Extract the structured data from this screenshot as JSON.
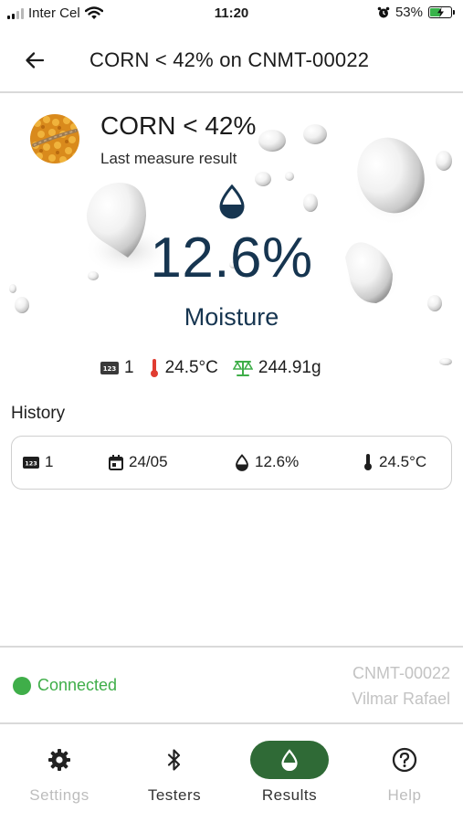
{
  "status_bar": {
    "carrier": "Inter Cel",
    "time": "11:20",
    "battery_percent": "53%",
    "battery_level": 0.53
  },
  "app_bar": {
    "title": "CORN < 42% on CNMT-00022",
    "back_icon": "arrow-left-icon"
  },
  "measurement": {
    "crop_name": "CORN < 42%",
    "subtitle": "Last measure result",
    "moisture_value": "12.6%",
    "moisture_label": "Moisture",
    "sample_number": "1",
    "temperature": "24.5°C",
    "weight": "244.91g"
  },
  "history": {
    "label": "History",
    "entries": [
      {
        "sample": "1",
        "date": "24/05",
        "moisture": "12.6%",
        "temperature": "24.5°C"
      }
    ]
  },
  "connection": {
    "status": "Connected",
    "device": "CNMT-00022",
    "user": "Vilmar Rafael",
    "status_color": "#3fae49"
  },
  "nav": {
    "items": [
      {
        "label": "Settings",
        "icon": "gear-icon"
      },
      {
        "label": "Testers",
        "icon": "bluetooth-icon"
      },
      {
        "label": "Results",
        "icon": "drop-icon"
      },
      {
        "label": "Help",
        "icon": "help-icon"
      }
    ],
    "active_color": "#2f6a36"
  },
  "colors": {
    "primary_text": "#163550",
    "accent_green": "#3fae49"
  }
}
